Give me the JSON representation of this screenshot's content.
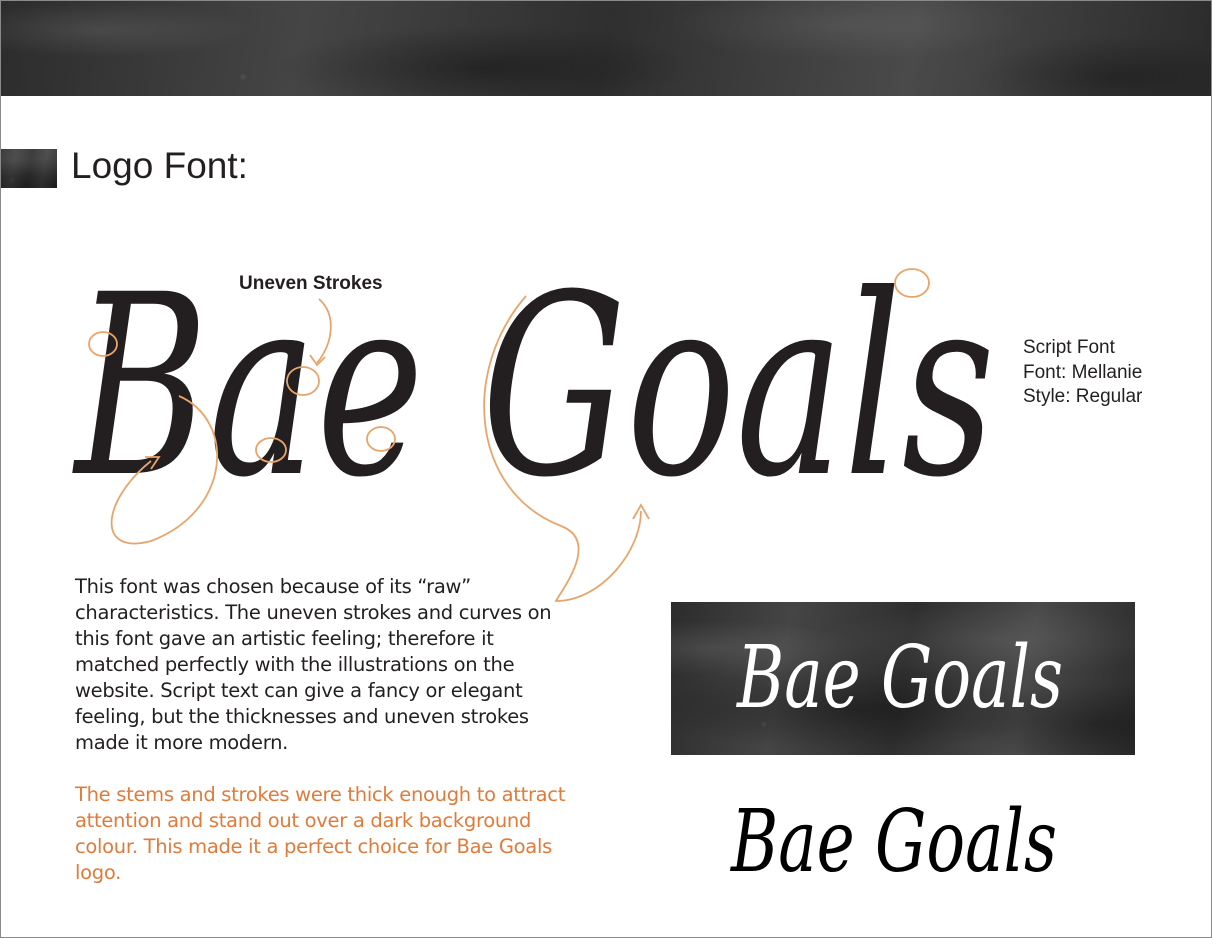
{
  "section": {
    "title": "Logo Font:"
  },
  "logo": {
    "wordmark": "Bae Goals",
    "annotation": "Uneven Strokes",
    "annotation_color": "#e8a56b",
    "ink_color": "#231f20"
  },
  "font_specs": [
    "Script Font",
    "Font: Mellanie",
    "Style: Regular"
  ],
  "description": "This font was chosen because of its “raw” characteristics. The uneven strokes and curves on this font gave an artistic feeling; therefore it matched perfectly with the illustrations on the website. Script text can give a fancy or elegant feeling, but the thicknesses and uneven strokes made it more modern.",
  "highlight": "The stems and strokes were thick enough to attract attention and stand out over a dark background colour. This made it a perfect choice for Bae Goals logo.",
  "colors": {
    "accent": "#e07b39",
    "text": "#231f20",
    "stone": "#3a3a3a"
  }
}
